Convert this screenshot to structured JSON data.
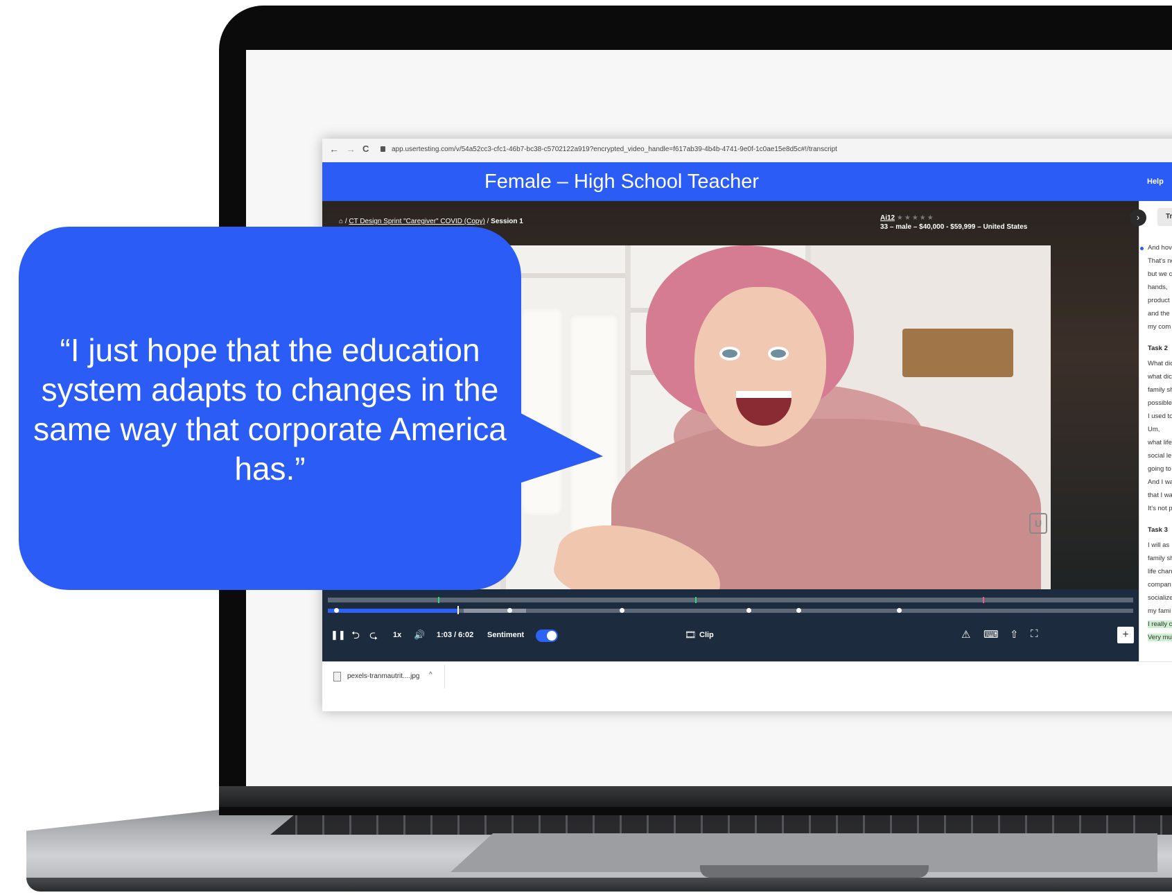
{
  "browser": {
    "url": "app.usertesting.com/v/54a52cc3-cfc1-46b7-bc38-c5702122a919?encrypted_video_handle=f617ab39-4b4b-4741-9e0f-1c0ae15e8d5c#!/transcript",
    "nav": {
      "back": "←",
      "forward": "→",
      "reload": "C"
    }
  },
  "banner": {
    "title": "Female – High School Teacher",
    "help": "Help"
  },
  "player": {
    "breadcrumb": {
      "home": "⌂",
      "project": "CT Design Sprint \"Caregiver\" COVID (Copy)",
      "session": "Session 1",
      "sep": "/"
    },
    "tester": {
      "name": "Ai12",
      "stars": "★★★★★",
      "demographics": "33 – male – $40,000 - $59,999 – United States"
    },
    "logo": "U",
    "progress_fraction": 0.161
  },
  "controls": {
    "pause": "❚❚",
    "rewind": "⮌",
    "forward": "⮎",
    "speed": "1x",
    "volume": "🔊",
    "time": "1:03 / 6:02",
    "sentiment_label": "Sentiment",
    "sentiment_on": true,
    "clip_label": "Clip",
    "clip_icon": "🎞",
    "warning_icon": "⚠",
    "keyboard_icon": "⌨",
    "share_icon": "⇧",
    "fullscreen_icon": "⛶",
    "add": "+"
  },
  "transcript": {
    "chevron": "›",
    "tab": "Tra",
    "block1": [
      "And hov",
      "That's no",
      "but we c",
      "hands,",
      "product",
      "and the",
      "my com"
    ],
    "task2": "Task 2",
    "block2": [
      "What dic",
      "what dic",
      "family sh",
      "possible",
      "I used to",
      "Um,",
      "what life",
      "social le",
      "going to",
      "And I wa",
      "that I wa",
      "It's not p"
    ],
    "task3": "Task 3",
    "block3": [
      "I will as",
      "family sh",
      "life chan",
      "compan",
      "socialize",
      "my fami"
    ],
    "highlighted": [
      "I really c",
      "Very mu"
    ]
  },
  "download": {
    "file": "pexels-tranmautrit....jpg",
    "chevron": "^"
  },
  "bubble": {
    "quote": "“I just hope that the education system adapts to changes in the same way that corporate America has.”"
  },
  "colors": {
    "brand_blue": "#2b5cf6",
    "timeline": "#1c2b3d",
    "progress": "#2e62f5"
  }
}
